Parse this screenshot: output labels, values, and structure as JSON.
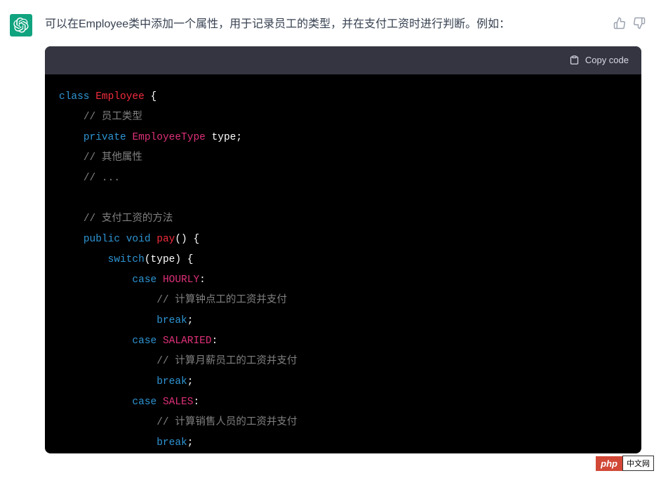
{
  "message": {
    "text": "可以在Employee类中添加一个属性，用于记录员工的类型，并在支付工资时进行判断。例如："
  },
  "code_header": {
    "copy_label": "Copy code"
  },
  "code": {
    "tokens": [
      [
        {
          "cls": "kw-class",
          "t": "class"
        },
        {
          "cls": "",
          "t": " "
        },
        {
          "cls": "class-name",
          "t": "Employee"
        },
        {
          "cls": "",
          "t": " "
        },
        {
          "cls": "brace",
          "t": "{"
        }
      ],
      [
        {
          "cls": "",
          "t": "    "
        },
        {
          "cls": "comment",
          "t": "// 员工类型"
        }
      ],
      [
        {
          "cls": "",
          "t": "    "
        },
        {
          "cls": "kw-private",
          "t": "private"
        },
        {
          "cls": "",
          "t": " "
        },
        {
          "cls": "type-name",
          "t": "EmployeeType"
        },
        {
          "cls": "",
          "t": " "
        },
        {
          "cls": "var-name",
          "t": "type"
        },
        {
          "cls": "",
          "t": ";"
        }
      ],
      [
        {
          "cls": "",
          "t": "    "
        },
        {
          "cls": "comment",
          "t": "// 其他属性"
        }
      ],
      [
        {
          "cls": "",
          "t": "    "
        },
        {
          "cls": "comment",
          "t": "// ..."
        }
      ],
      [],
      [
        {
          "cls": "",
          "t": "    "
        },
        {
          "cls": "comment",
          "t": "// 支付工资的方法"
        }
      ],
      [
        {
          "cls": "",
          "t": "    "
        },
        {
          "cls": "kw-public",
          "t": "public"
        },
        {
          "cls": "",
          "t": " "
        },
        {
          "cls": "kw-void",
          "t": "void"
        },
        {
          "cls": "",
          "t": " "
        },
        {
          "cls": "method-name",
          "t": "pay"
        },
        {
          "cls": "paren",
          "t": "()"
        },
        {
          "cls": "",
          "t": " "
        },
        {
          "cls": "brace",
          "t": "{"
        }
      ],
      [
        {
          "cls": "",
          "t": "        "
        },
        {
          "cls": "kw-switch",
          "t": "switch"
        },
        {
          "cls": "paren",
          "t": "("
        },
        {
          "cls": "var-name",
          "t": "type"
        },
        {
          "cls": "paren",
          "t": ")"
        },
        {
          "cls": "",
          "t": " "
        },
        {
          "cls": "brace",
          "t": "{"
        }
      ],
      [
        {
          "cls": "",
          "t": "            "
        },
        {
          "cls": "kw-case",
          "t": "case"
        },
        {
          "cls": "",
          "t": " "
        },
        {
          "cls": "case-val",
          "t": "HOURLY"
        },
        {
          "cls": "",
          "t": ":"
        }
      ],
      [
        {
          "cls": "",
          "t": "                "
        },
        {
          "cls": "comment",
          "t": "// 计算钟点工的工资并支付"
        }
      ],
      [
        {
          "cls": "",
          "t": "                "
        },
        {
          "cls": "kw-break",
          "t": "break"
        },
        {
          "cls": "",
          "t": ";"
        }
      ],
      [
        {
          "cls": "",
          "t": "            "
        },
        {
          "cls": "kw-case",
          "t": "case"
        },
        {
          "cls": "",
          "t": " "
        },
        {
          "cls": "case-val",
          "t": "SALARIED"
        },
        {
          "cls": "",
          "t": ":"
        }
      ],
      [
        {
          "cls": "",
          "t": "                "
        },
        {
          "cls": "comment",
          "t": "// 计算月薪员工的工资并支付"
        }
      ],
      [
        {
          "cls": "",
          "t": "                "
        },
        {
          "cls": "kw-break",
          "t": "break"
        },
        {
          "cls": "",
          "t": ";"
        }
      ],
      [
        {
          "cls": "",
          "t": "            "
        },
        {
          "cls": "kw-case",
          "t": "case"
        },
        {
          "cls": "",
          "t": " "
        },
        {
          "cls": "case-val",
          "t": "SALES"
        },
        {
          "cls": "",
          "t": ":"
        }
      ],
      [
        {
          "cls": "",
          "t": "                "
        },
        {
          "cls": "comment",
          "t": "// 计算销售人员的工资并支付"
        }
      ],
      [
        {
          "cls": "",
          "t": "                "
        },
        {
          "cls": "kw-break",
          "t": "break"
        },
        {
          "cls": "",
          "t": ";"
        }
      ]
    ]
  },
  "watermark": {
    "php": "php",
    "cn": "中文网"
  }
}
